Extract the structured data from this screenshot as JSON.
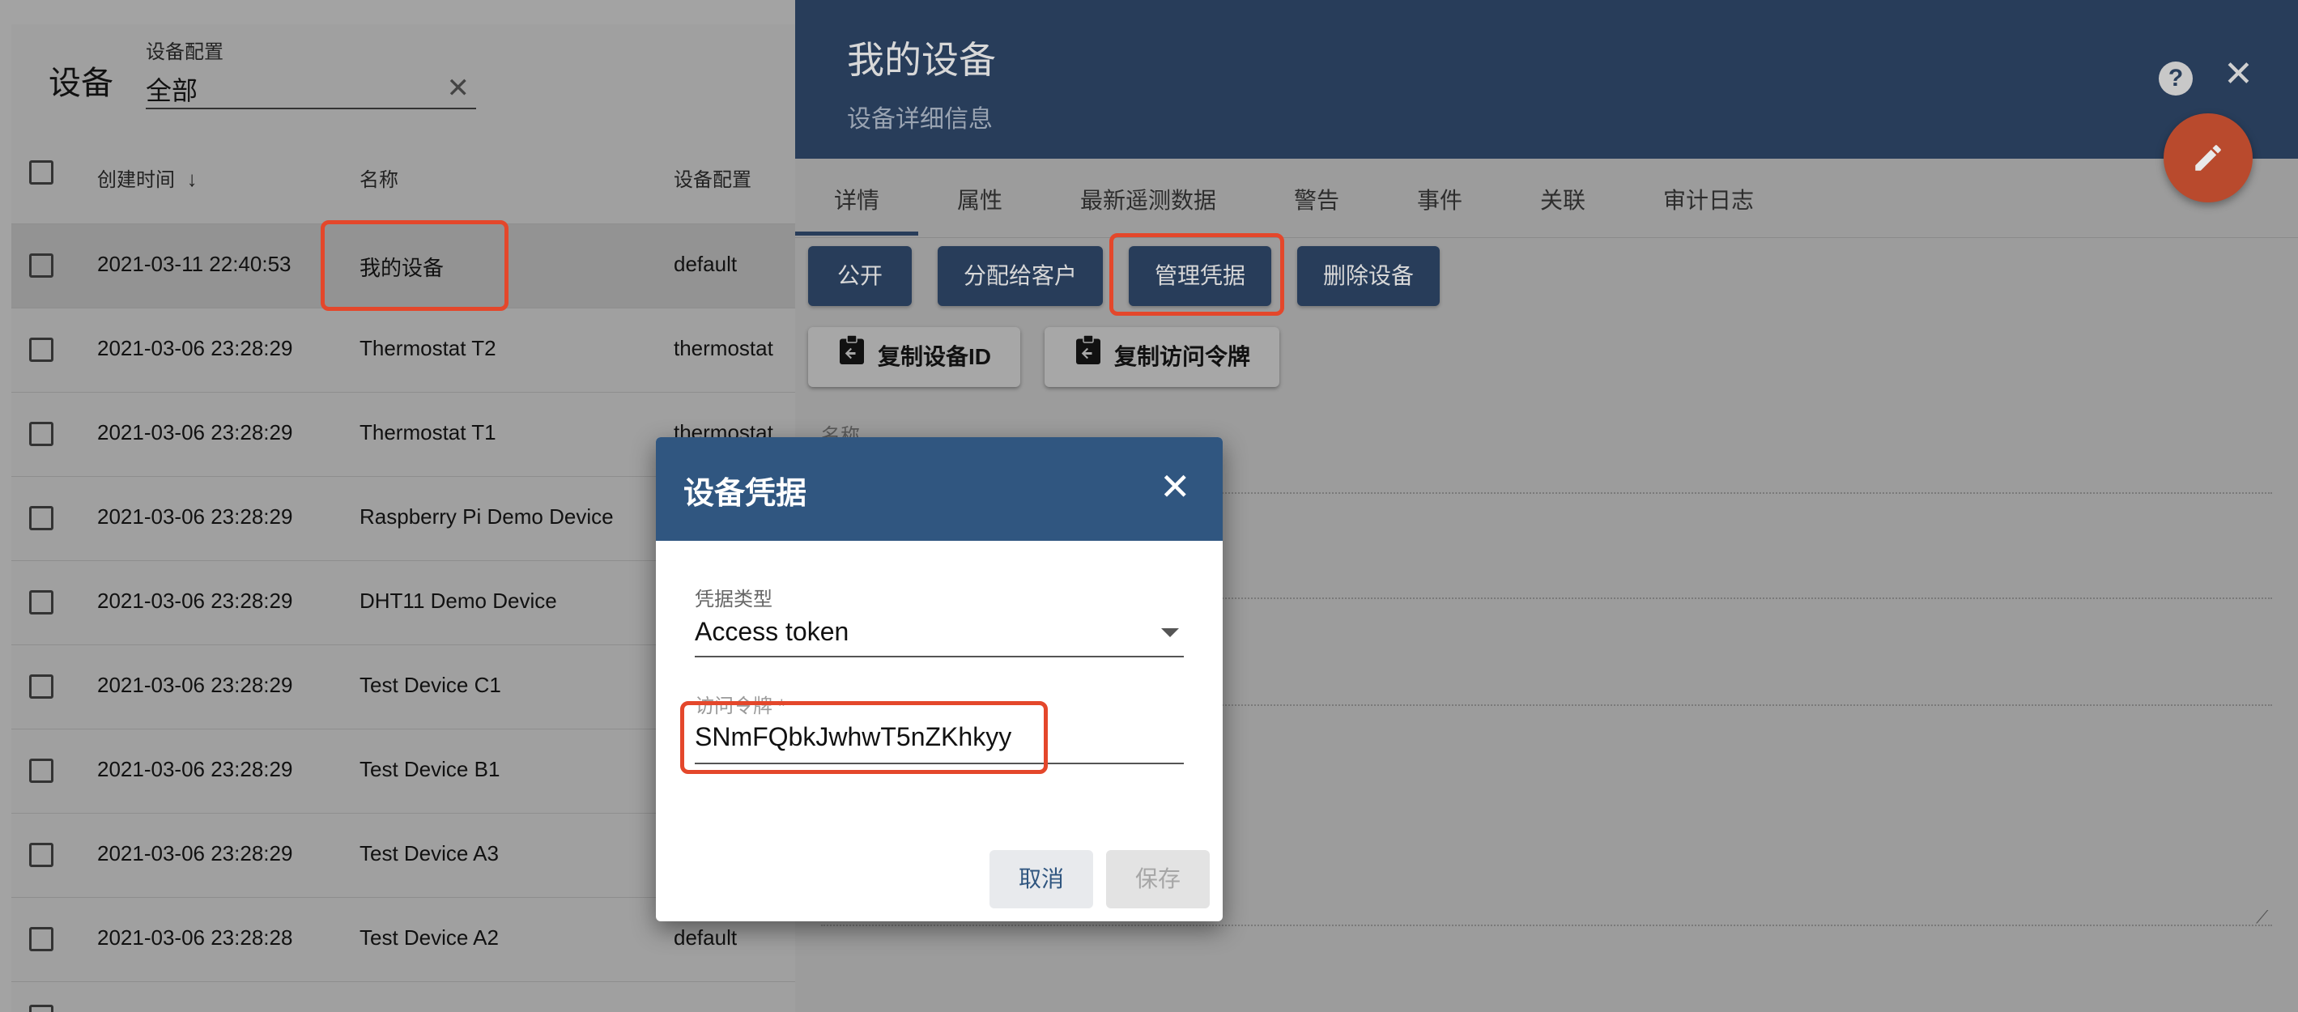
{
  "list": {
    "title": "设备",
    "filter": {
      "label": "设备配置",
      "value": "全部"
    },
    "columns": {
      "created": "创建时间",
      "name": "名称",
      "profile": "设备配置"
    },
    "rows": [
      {
        "created": "2021-03-11 22:40:53",
        "name": "我的设备",
        "profile": "default"
      },
      {
        "created": "2021-03-06 23:28:29",
        "name": "Thermostat T2",
        "profile": "thermostat"
      },
      {
        "created": "2021-03-06 23:28:29",
        "name": "Thermostat T1",
        "profile": "thermostat"
      },
      {
        "created": "2021-03-06 23:28:29",
        "name": "Raspberry Pi Demo Device",
        "profile": ""
      },
      {
        "created": "2021-03-06 23:28:29",
        "name": "DHT11 Demo Device",
        "profile": ""
      },
      {
        "created": "2021-03-06 23:28:29",
        "name": "Test Device C1",
        "profile": ""
      },
      {
        "created": "2021-03-06 23:28:29",
        "name": "Test Device B1",
        "profile": ""
      },
      {
        "created": "2021-03-06 23:28:29",
        "name": "Test Device A3",
        "profile": ""
      },
      {
        "created": "2021-03-06 23:28:28",
        "name": "Test Device A2",
        "profile": "default"
      }
    ]
  },
  "panel": {
    "title": "我的设备",
    "subtitle": "设备详细信息",
    "tabs": [
      "详情",
      "属性",
      "最新遥测数据",
      "警告",
      "事件",
      "关联",
      "审计日志"
    ],
    "actions": {
      "public": "公开",
      "assign": "分配给客户",
      "manage_credentials": "管理凭据",
      "delete": "删除设备",
      "copy_id": "复制设备ID",
      "copy_token": "复制访问令牌"
    },
    "fields": {
      "name_label": "名称"
    }
  },
  "dialog": {
    "title": "设备凭据",
    "credential_type_label": "凭据类型",
    "credential_type_value": "Access token",
    "token_label": "访问令牌 *",
    "token_value": "SNmFQbkJwhwT5nZKhkyy",
    "cancel": "取消",
    "save": "保存"
  },
  "colors": {
    "header_navy": "#283d5a",
    "dialog_header": "#305680",
    "highlight_red": "#e4472b",
    "fab_orange": "#b94a2d"
  }
}
